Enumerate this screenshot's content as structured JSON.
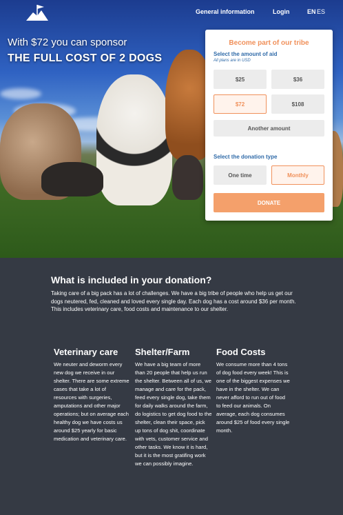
{
  "nav": {
    "general_info": "General information",
    "login": "Login",
    "lang_en": "EN",
    "lang_es": "ES",
    "logo_icon": "tribe-flag-logo"
  },
  "hero": {
    "line1": "With $72 you can sponsor",
    "line2": "THE FULL COST OF 2 DOGS"
  },
  "card": {
    "title": "Become part of our tribe",
    "amount_label": "Select the amount of aid",
    "amount_note": "All plans are in USD",
    "amounts": [
      "$25",
      "$36",
      "$72",
      "$108"
    ],
    "selected_amount": "$72",
    "another_amount": "Another amount",
    "type_label": "Select the donation type",
    "types": [
      "One time",
      "Monthly"
    ],
    "selected_type": "Monthly",
    "donate_label": "DONATE"
  },
  "content": {
    "heading": "What is included in your donation?",
    "intro": "Taking care of a big pack has a lot of challenges. We have a big tribe of people who help us get our dogs neutered, fed, cleaned and loved every single day. Each dog has a cost around $36 per month. This includes veterinary care, food costs and maintenance to our shelter.",
    "columns": [
      {
        "title": "Veterinary care",
        "text": "We neuter and deworm every new dog we receive in our shelter. There are some extreme cases that take a lot of resources with surgeries, amputations and other major operations; but on average each healthy dog we have costs us around $25 yearly for basic medication and veterinary care."
      },
      {
        "title": "Shelter/Farm",
        "text": "We have a big team of more than 20 people that help us run the shelter. Between all of us, we manage and care for the pack, feed every single dog, take them for daily walks around the farm, do logistics to get dog food to the shelter, clean their space, pick up tons of dog shit, coordinate with vets, customer service and other tasks. We know it is hard, but it is the most gratifing work we can possibly imagine."
      },
      {
        "title": "Food Costs",
        "text": "We consume more than 4 tons of dog food every week! This is one of the biggest expenses we have in the shelter. We can never afford to run out of food to feed our animals. On average, each dog consumes around $25 of food every single month."
      }
    ]
  },
  "colors": {
    "accent": "#f0905a",
    "label_blue": "#2f6aa8",
    "dark_bg": "#353a44"
  }
}
